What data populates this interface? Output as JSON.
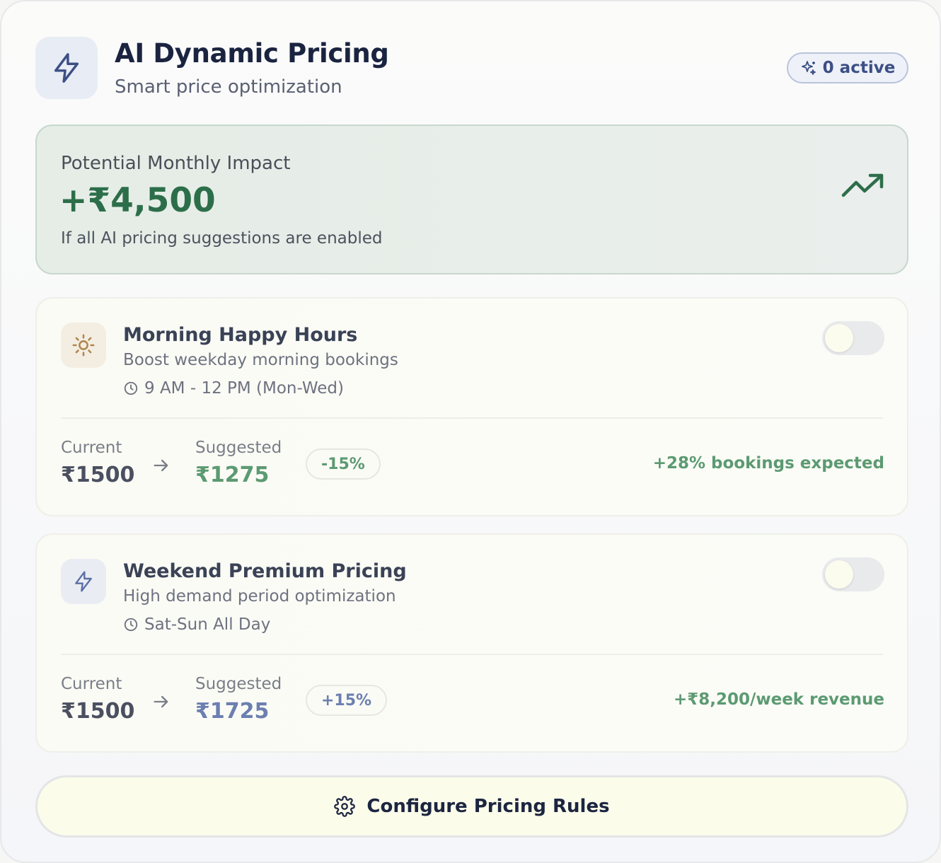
{
  "header": {
    "title": "AI Dynamic Pricing",
    "subtitle": "Smart price optimization",
    "icon": "lightning-icon",
    "badge": {
      "icon": "sparkle-icon",
      "label": "0 active"
    }
  },
  "impact": {
    "label": "Potential Monthly Impact",
    "value": "+₹4,500",
    "note": "If all AI pricing suggestions are enabled",
    "icon": "trending-up-icon"
  },
  "rules": [
    {
      "icon": "sun-icon",
      "title": "Morning Happy Hours",
      "description": "Boost weekday morning bookings",
      "time": "9 AM - 12 PM (Mon-Wed)",
      "enabled": false,
      "current_label": "Current",
      "current_price": "₹1500",
      "suggested_label": "Suggested",
      "suggested_price": "₹1275",
      "change": "-15%",
      "outcome": "+28% bookings expected"
    },
    {
      "icon": "lightning-icon",
      "title": "Weekend Premium Pricing",
      "description": "High demand period optimization",
      "time": "Sat-Sun All Day",
      "enabled": false,
      "current_label": "Current",
      "current_price": "₹1500",
      "suggested_label": "Suggested",
      "suggested_price": "₹1725",
      "change": "+15%",
      "outcome": "+₹8,200/week revenue"
    }
  ],
  "footer": {
    "button_label": "Configure Pricing Rules",
    "icon": "gear-icon"
  },
  "colors": {
    "primary": "#1a2440",
    "accent_blue": "#3c4f85",
    "positive_green": "#2d6e4a",
    "muted_green": "#5c9a72",
    "muted_blue": "#6b7fb0"
  }
}
